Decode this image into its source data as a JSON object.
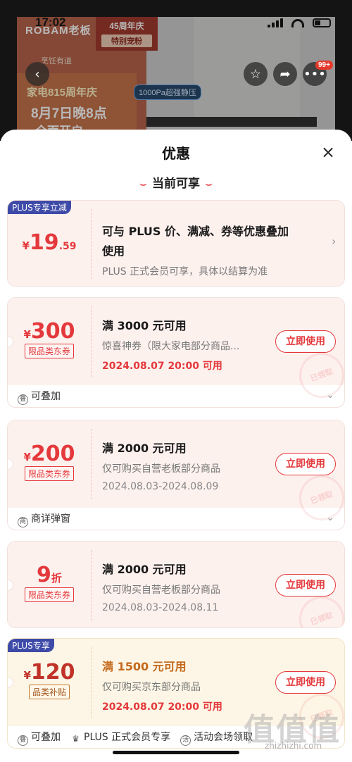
{
  "status_bar": {
    "time": "17:02"
  },
  "background": {
    "brand": "ROBAM老板",
    "slogan": "烹饪有道",
    "anniv_tag": "45周年庆",
    "anniv_sub": "特别宠粉",
    "promo_line1": "家电815周年庆",
    "promo_line2": "8月7日晚8点",
    "promo_line3": "全面开启",
    "feature_pill": "1000Pa超强静压",
    "cart_badge": "99+"
  },
  "sheet": {
    "title": "优惠",
    "close_glyph": "×",
    "section_title": "当前可享",
    "section_deco": "⌣"
  },
  "plus_card": {
    "corner_tag": "PLUS专享立减",
    "currency": "¥",
    "price_int": "19",
    "price_dec": ".59",
    "title_line1": "可与 PLUS 价、满减、券等优惠叠加",
    "title_line2": "使用",
    "desc": "PLUS 正式会员可享，具体以结算为准"
  },
  "coupons": [
    {
      "currency": "¥",
      "amount": "300",
      "tag": "限品类东券",
      "title": "满 3000 元可用",
      "desc": "惊喜神券（限大家电部分商品...",
      "date": "2024.08.07 20:00 可用",
      "button": "立即使用",
      "stamp": "已领取",
      "footer": [
        {
          "icon": "叠",
          "label": "可叠加"
        }
      ]
    },
    {
      "currency": "¥",
      "amount": "200",
      "tag": "限品类东券",
      "title": "满 2000 元可用",
      "desc": "仅可购买自营老板部分商品",
      "date": "2024.08.03-2024.08.09",
      "button": "立即使用",
      "stamp": "已领取",
      "footer": [
        {
          "icon": "商",
          "label": "商详弹窗"
        }
      ]
    },
    {
      "amount": "9",
      "unit": "折",
      "tag": "限品类东券",
      "title": "满 2000 元可用",
      "desc": "仅可购买自营老板部分商品",
      "date": "2024.08.03-2024.08.11",
      "button": "立即使用",
      "stamp": "已领取"
    },
    {
      "corner_tag": "PLUS专享",
      "currency": "¥",
      "amount": "120",
      "tag": "品类补贴",
      "title": "满 1500 元可用",
      "desc": "仅可购买京东部分商品",
      "date": "2024.08.07 20:00 可用",
      "button": "立即使用",
      "stamp": "已领取",
      "footer": [
        {
          "icon": "叠",
          "label": "可叠加"
        },
        {
          "icon": "♛",
          "label": "PLUS 正式会员专享"
        },
        {
          "icon": "活",
          "label": "活动会场领取"
        }
      ]
    }
  ],
  "chevron_down": "⌄",
  "chevron_right": "›",
  "watermark": "值值值",
  "watermark_url": "zhizhizhi.com",
  "colors": {
    "accent": "#e4393c",
    "plus": "#3e4aa8",
    "gold_bg": "#fdf6e6",
    "card_bg": "#fdf1ee"
  }
}
